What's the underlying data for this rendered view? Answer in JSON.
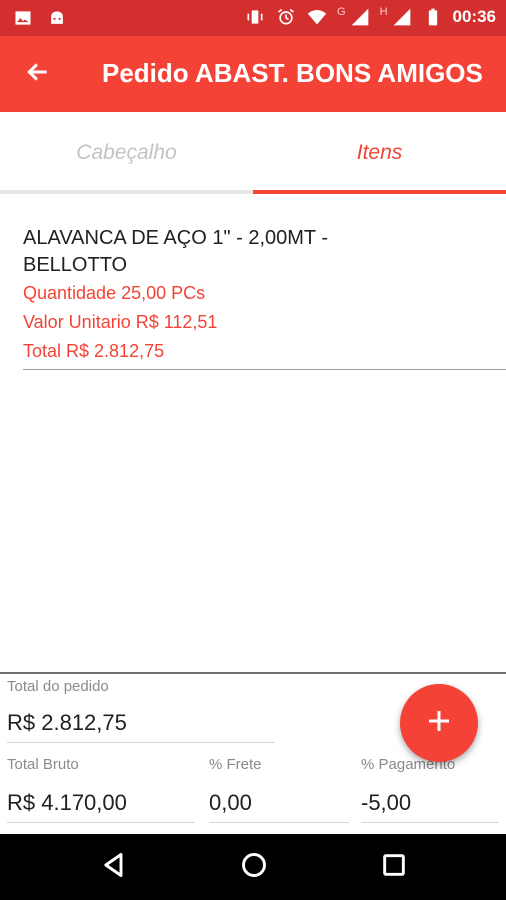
{
  "status_bar": {
    "icons": [
      "image-icon",
      "android-icon",
      "vibrate-icon",
      "alarm-icon",
      "wifi-icon",
      "signal-icon",
      "signal-icon",
      "battery-icon"
    ],
    "network_g": "G",
    "network_h": "H",
    "time": "00:36"
  },
  "app_bar": {
    "back_icon": "arrow-back-icon",
    "title": "Pedido ABAST. BONS AMIGOS"
  },
  "tabs": [
    {
      "label": "Cabeçalho",
      "active": false
    },
    {
      "label": "Itens",
      "active": true
    }
  ],
  "items": [
    {
      "name": "ALAVANCA DE AÇO 1\" - 2,00MT - BELLOTTO",
      "quantity": "Quantidade 25,00 PCs",
      "unit_value": "Valor Unitario R$ 112,51",
      "total": "Total R$ 2.812,75"
    }
  ],
  "footer": {
    "total_pedido_label": "Total do pedido",
    "total_pedido_value": "R$ 2.812,75",
    "total_bruto_label": "Total Bruto",
    "total_bruto_value": "R$ 4.170,00",
    "frete_label": "% Frete",
    "frete_value": "0,00",
    "pagamento_label": "% Pagamento",
    "pagamento_value": "-5,00"
  },
  "fab": {
    "icon": "plus-icon"
  },
  "nav_bar": {
    "icons": [
      "back-triangle-icon",
      "home-circle-icon",
      "recents-square-icon"
    ]
  },
  "colors": {
    "primary": "#f44336",
    "primary_dark": "#d32f2f",
    "tab_inactive": "#c3c3c3"
  }
}
